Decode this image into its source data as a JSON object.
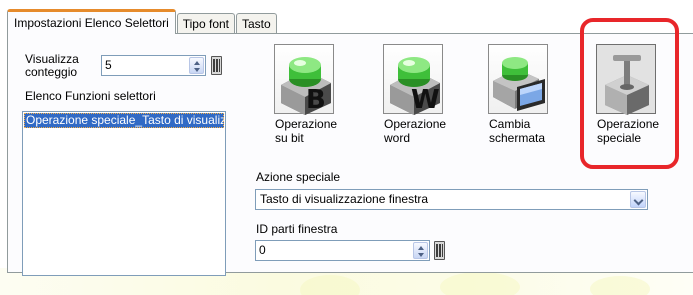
{
  "tabs": [
    {
      "label": "Impostazioni Elenco Selettori",
      "active": true
    },
    {
      "label": "Tipo font",
      "active": false
    },
    {
      "label": "Tasto",
      "active": false
    }
  ],
  "left": {
    "display_count_label_1": "Visualizza",
    "display_count_label_2": "conteggio",
    "display_count_value": "5",
    "function_list_label": "Elenco Funzioni selettori",
    "function_list_items": [
      "Operazione speciale_Tasto di visualizzazione finestra"
    ]
  },
  "operations": [
    {
      "line1": "Operazione",
      "line2": "su bit",
      "icon": "bit-switch-icon",
      "letter": "B"
    },
    {
      "line1": "Operazione",
      "line2": "word",
      "icon": "word-switch-icon",
      "letter": "W"
    },
    {
      "line1": "Cambia",
      "line2": "schermata",
      "icon": "screen-switch-icon"
    },
    {
      "line1": "Operazione",
      "line2": "speciale",
      "icon": "special-operation-icon",
      "selected": true
    }
  ],
  "special_action": {
    "label": "Azione speciale",
    "selected": "Tasto di visualizzazione finestra"
  },
  "window_id": {
    "label": "ID parti finestra",
    "value": "0"
  },
  "colors": {
    "active_tab_accent": "#e68b2c",
    "selection_blue": "#316ac5",
    "highlight_red": "#e8262a",
    "switch_green": "#3fbf3a"
  }
}
